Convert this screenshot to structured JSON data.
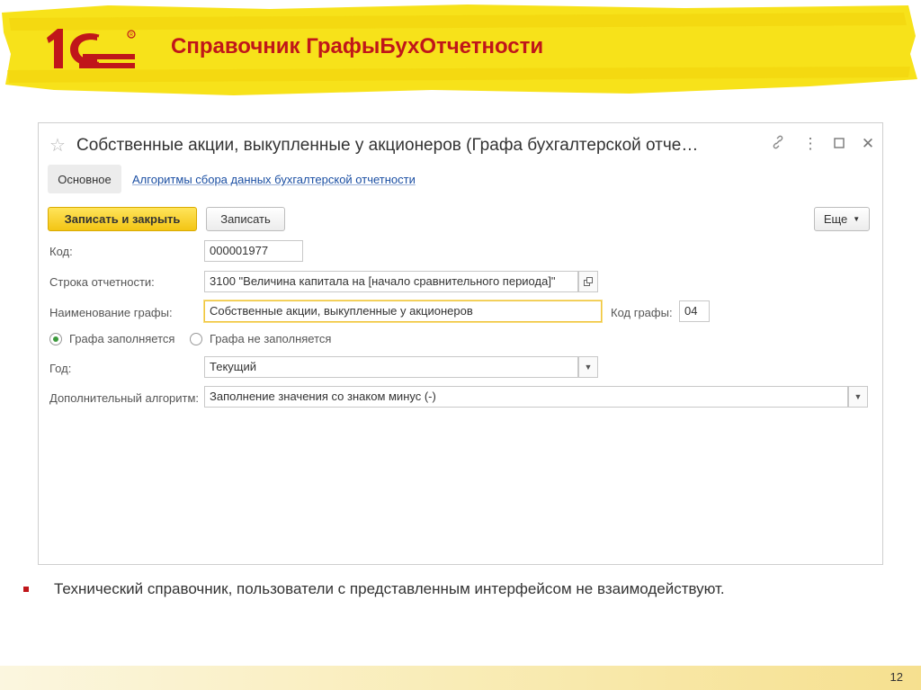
{
  "slide": {
    "title": "Справочник ГрафыБухОтчетности",
    "page_number": "12",
    "bullet_text": "Технический справочник, пользователи с представленным интерфейсом не взаимодействуют."
  },
  "colors": {
    "accent_yellow": "#f7e21a",
    "title_red": "#c0161a",
    "link_blue": "#1b4fa3"
  },
  "window": {
    "title": "Собственные акции, выкупленные у акционеров (Графа бухгалтерской отче…",
    "icons": [
      "star-icon",
      "link-icon",
      "more-icon",
      "maximize-icon",
      "close-icon"
    ]
  },
  "tabs": {
    "main": "Основное",
    "algorithms": "Алгоритмы сбора данных бухгалтерской отчетности"
  },
  "toolbar": {
    "save_close": "Записать и закрыть",
    "save": "Записать",
    "more": "Еще"
  },
  "form": {
    "code_label": "Код:",
    "code_value": "000001977",
    "row_label": "Строка отчетности:",
    "row_value": "3100 \"Величина капитала на [начало сравнительного периода]\"",
    "name_label": "Наименование графы:",
    "name_value": "Собственные акции, выкупленные у акционеров",
    "col_code_label": "Код графы:",
    "col_code_value": "04",
    "radio_filled": "Графа заполняется",
    "radio_not_filled": "Графа не заполняется",
    "radio_selected": "Графа заполняется",
    "year_label": "Год:",
    "year_value": "Текущий",
    "algo_label": "Дополнительный алгоритм:",
    "algo_value": "Заполнение значения со знаком минус (-)"
  }
}
